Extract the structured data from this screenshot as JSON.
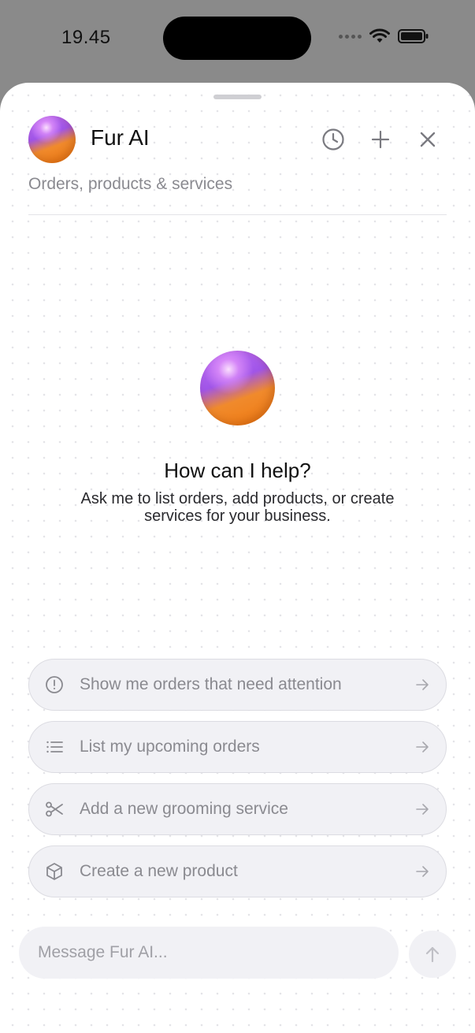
{
  "status_bar": {
    "time": "19.45"
  },
  "header": {
    "title": "Fur AI",
    "subtitle": "Orders, products & services",
    "icons": [
      "history-icon",
      "plus-icon",
      "close-icon"
    ]
  },
  "hero": {
    "title": "How can I help?",
    "subtitle": "Ask me to list orders, add products, or create services for your business."
  },
  "suggestions": [
    {
      "label": "Show me orders that need attention",
      "icon": "alert-circle-icon"
    },
    {
      "label": "List my upcoming orders",
      "icon": "list-icon"
    },
    {
      "label": "Add a new grooming service",
      "icon": "scissors-icon"
    },
    {
      "label": "Create a new product",
      "icon": "box-icon"
    }
  ],
  "composer": {
    "placeholder": "Message Fur AI..."
  },
  "colors": {
    "orb_purple": "#a055e8",
    "orb_orange": "#f07a10",
    "muted_text": "#8a8a90"
  }
}
